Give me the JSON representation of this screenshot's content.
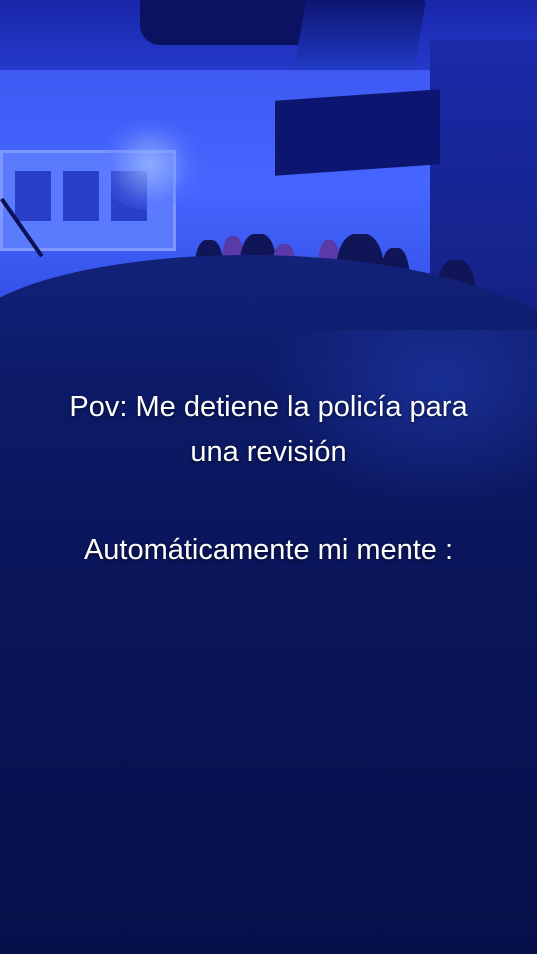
{
  "caption": {
    "line1": "Pov: Me detiene la policía para",
    "line2": "una revisión",
    "line3": "Automáticamente mi mente :"
  },
  "colors": {
    "scene_light": "#3d59f2",
    "scene_dark": "#060d40",
    "text": "#ffffff"
  }
}
